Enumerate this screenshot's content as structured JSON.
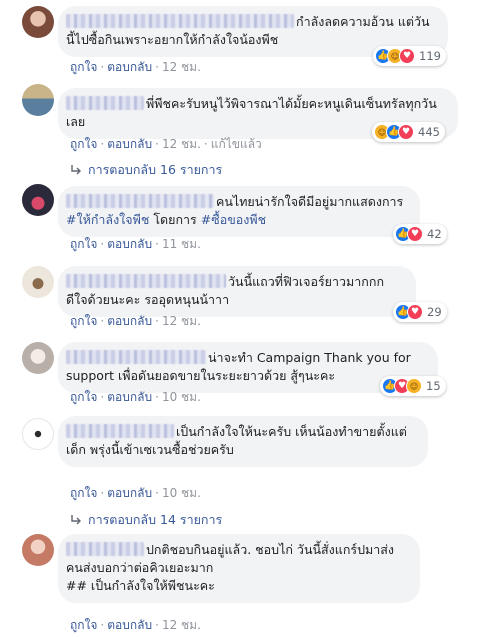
{
  "comments": [
    {
      "text": "กำลังลดความอ้วน แต่วันนี้ไปซื้อกินเพราะอยากให้กำลังใจน้องพีช",
      "reaction_count": "119",
      "actions": {
        "like": "ถูกใจ",
        "reply": "ตอบกลับ",
        "time": "12 ชม."
      }
    },
    {
      "text": "พี่พีชคะรับหนูไว้พิจารณาได้มั้ยคะหนูเดินเซ็นทรัลทุกวันเลย",
      "reaction_count": "445",
      "actions": {
        "like": "ถูกใจ",
        "reply": "ตอบกลับ",
        "time": "12 ชม.",
        "edited": "แก้ไขแล้ว"
      },
      "replies": "การตอบกลับ 16 รายการ"
    },
    {
      "text_prefix": "คนไทยน่ารักใจดีมีอยู่มากแสดงการ",
      "hashtag1": "#ให้กำลังใจพีช",
      "text_mid": "โดยการ",
      "hashtag2": "#ซื้อของพีช",
      "reaction_count": "42",
      "actions": {
        "like": "ถูกใจ",
        "reply": "ตอบกลับ",
        "time": "11 ชม."
      }
    },
    {
      "text": "วันนี้แถวที่ฟิวเจอร์ยาวมากกก ดีใจด้วยนะคะ รออุดหนุนน้าาา",
      "reaction_count": "29",
      "actions": {
        "like": "ถูกใจ",
        "reply": "ตอบกลับ",
        "time": "12 ชม."
      }
    },
    {
      "text": "น่าจะทำ Campaign Thank you for support เพื่อดันยอดขายในระยะยาวด้วย สู้ๆนะคะ",
      "reaction_count": "15",
      "actions": {
        "like": "ถูกใจ",
        "reply": "ตอบกลับ",
        "time": "10 ชม."
      }
    },
    {
      "text": "เป็นกำลังใจให้นะครับ เห็นน้องทำขายตั้งแต่เด็ก พรุ่งนี้เข้าเซเวนซื้อช่วยครับ",
      "actions": {
        "like": "ถูกใจ",
        "reply": "ตอบกลับ",
        "time": "10 ชม."
      },
      "replies": "การตอบกลับ 14 รายการ"
    },
    {
      "text_line1": "ปกติชอบกินอยู่แล้ว. ชอบไก่ วันนี้สั่งแกร์ปมาส่ง",
      "text_line2": "คนส่งบอกว่าต่อคิวเยอะมาก",
      "text_line3": "## เป็นกำลังใจให้พีชนะคะ",
      "actions": {
        "like": "ถูกใจ",
        "reply": "ตอบกลับ",
        "time": "12 ชม."
      }
    }
  ],
  "colors": {
    "link": "#385898",
    "bubble": "#f2f3f5",
    "like": "#1877f2",
    "love": "#f33e58",
    "haha": "#f7b125"
  }
}
